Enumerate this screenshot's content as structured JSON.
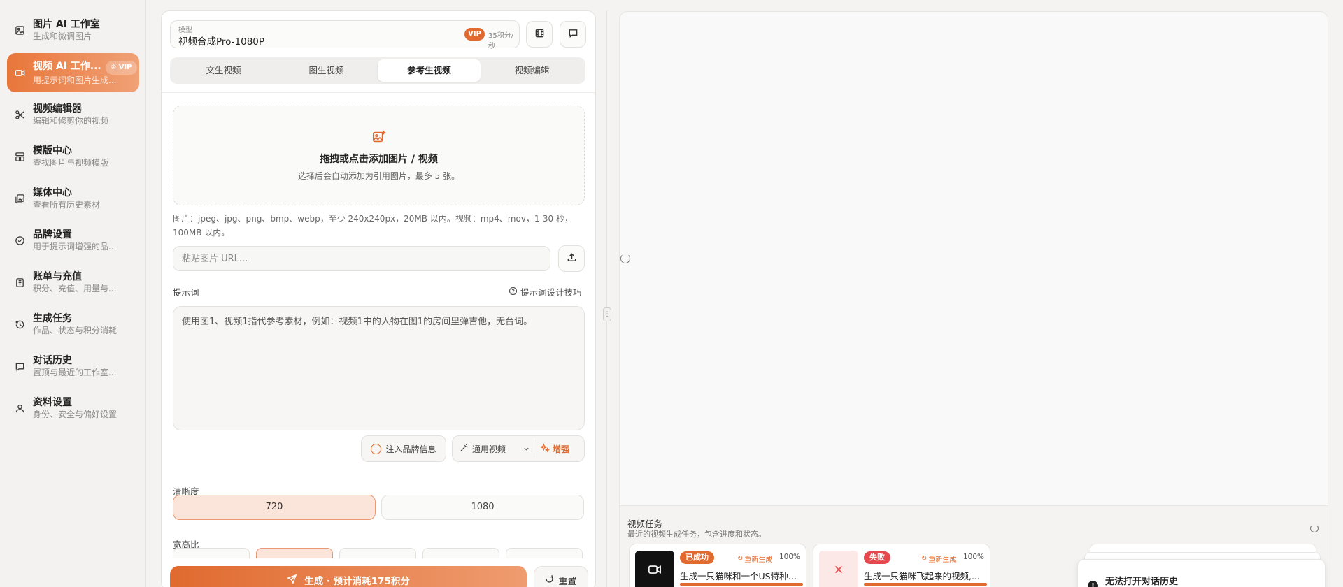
{
  "sidebar": {
    "items": [
      {
        "title": "图片 AI 工作室",
        "subtitle": "生成和微调图片",
        "icon": "image-icon"
      },
      {
        "title": "视频 AI 工作...",
        "subtitle": "用提示词和图片生成...",
        "icon": "video-camera-icon",
        "badge": "VIP",
        "active": true
      },
      {
        "title": "视频编辑器",
        "subtitle": "编辑和修剪你的视频",
        "icon": "scissors-icon"
      },
      {
        "title": "模版中心",
        "subtitle": "查找图片与视频模版",
        "icon": "layout-template-icon"
      },
      {
        "title": "媒体中心",
        "subtitle": "查看所有历史素材",
        "icon": "media-gallery-icon"
      },
      {
        "title": "品牌设置",
        "subtitle": "用于提示词增强的品...",
        "icon": "badge-check-icon"
      },
      {
        "title": "账单与充值",
        "subtitle": "积分、充值、用量与...",
        "icon": "receipt-icon"
      },
      {
        "title": "生成任务",
        "subtitle": "作品、状态与积分消耗",
        "icon": "history-icon"
      },
      {
        "title": "对话历史",
        "subtitle": "置顶与最近的工作室...",
        "icon": "chat-icon"
      },
      {
        "title": "资料设置",
        "subtitle": "身份、安全与偏好设置",
        "icon": "user-icon"
      }
    ]
  },
  "model": {
    "label": "模型",
    "value": "视频合成Pro-1080P",
    "vip": "VIP",
    "rate": "35积分/秒"
  },
  "tabs": [
    "文生视频",
    "图生视频",
    "参考生视频",
    "视频编辑"
  ],
  "active_tab": 2,
  "dropzone": {
    "title": "拖拽或点击添加图片 / 视频",
    "subtitle": "选择后会自动添加为引用图片，最多 5 张。"
  },
  "formats_note": "图片：jpeg、jpg、png、bmp、webp，至少 240x240px，20MB 以内。视频：mp4、mov，1-30 秒，100MB 以内。",
  "url_placeholder": "粘贴图片 URL...",
  "prompt": {
    "label": "提示词",
    "tips": "提示词设计技巧",
    "value": "使用图1、视频1指代参考素材，例如：视频1中的人物在图1的房间里弹吉他，无台词。"
  },
  "options": {
    "brand": "注入品牌信息",
    "general_video": "通用视频",
    "enhance": "增强"
  },
  "resolution": {
    "label": "清晰度",
    "options": [
      "720",
      "1080"
    ],
    "selected": "720"
  },
  "aspect": {
    "label": "宽高比"
  },
  "actions": {
    "generate": "生成 · 预计消耗175积分",
    "reset": "重置"
  },
  "tasks": {
    "title": "视频任务",
    "subtitle": "最近的视频生成任务，包含进度和状态。",
    "items": [
      {
        "status": "已成功",
        "status_color": "#e06a2f",
        "regen": "重新生成",
        "progress": "100%",
        "progress_value": 1.0,
        "text": "生成一只猫咪和一个US特种兵..."
      },
      {
        "status": "失败",
        "status_color": "#e5484d",
        "regen": "重新生成",
        "progress": "100%",
        "progress_value": 1.0,
        "text": "生成一只猫咪飞起来的视频,..."
      }
    ]
  },
  "toast": {
    "message": "无法打开对话历史"
  },
  "colors": {
    "accent": "#e06a2f",
    "accent_light": "#fbe4da",
    "danger": "#e5484d"
  }
}
